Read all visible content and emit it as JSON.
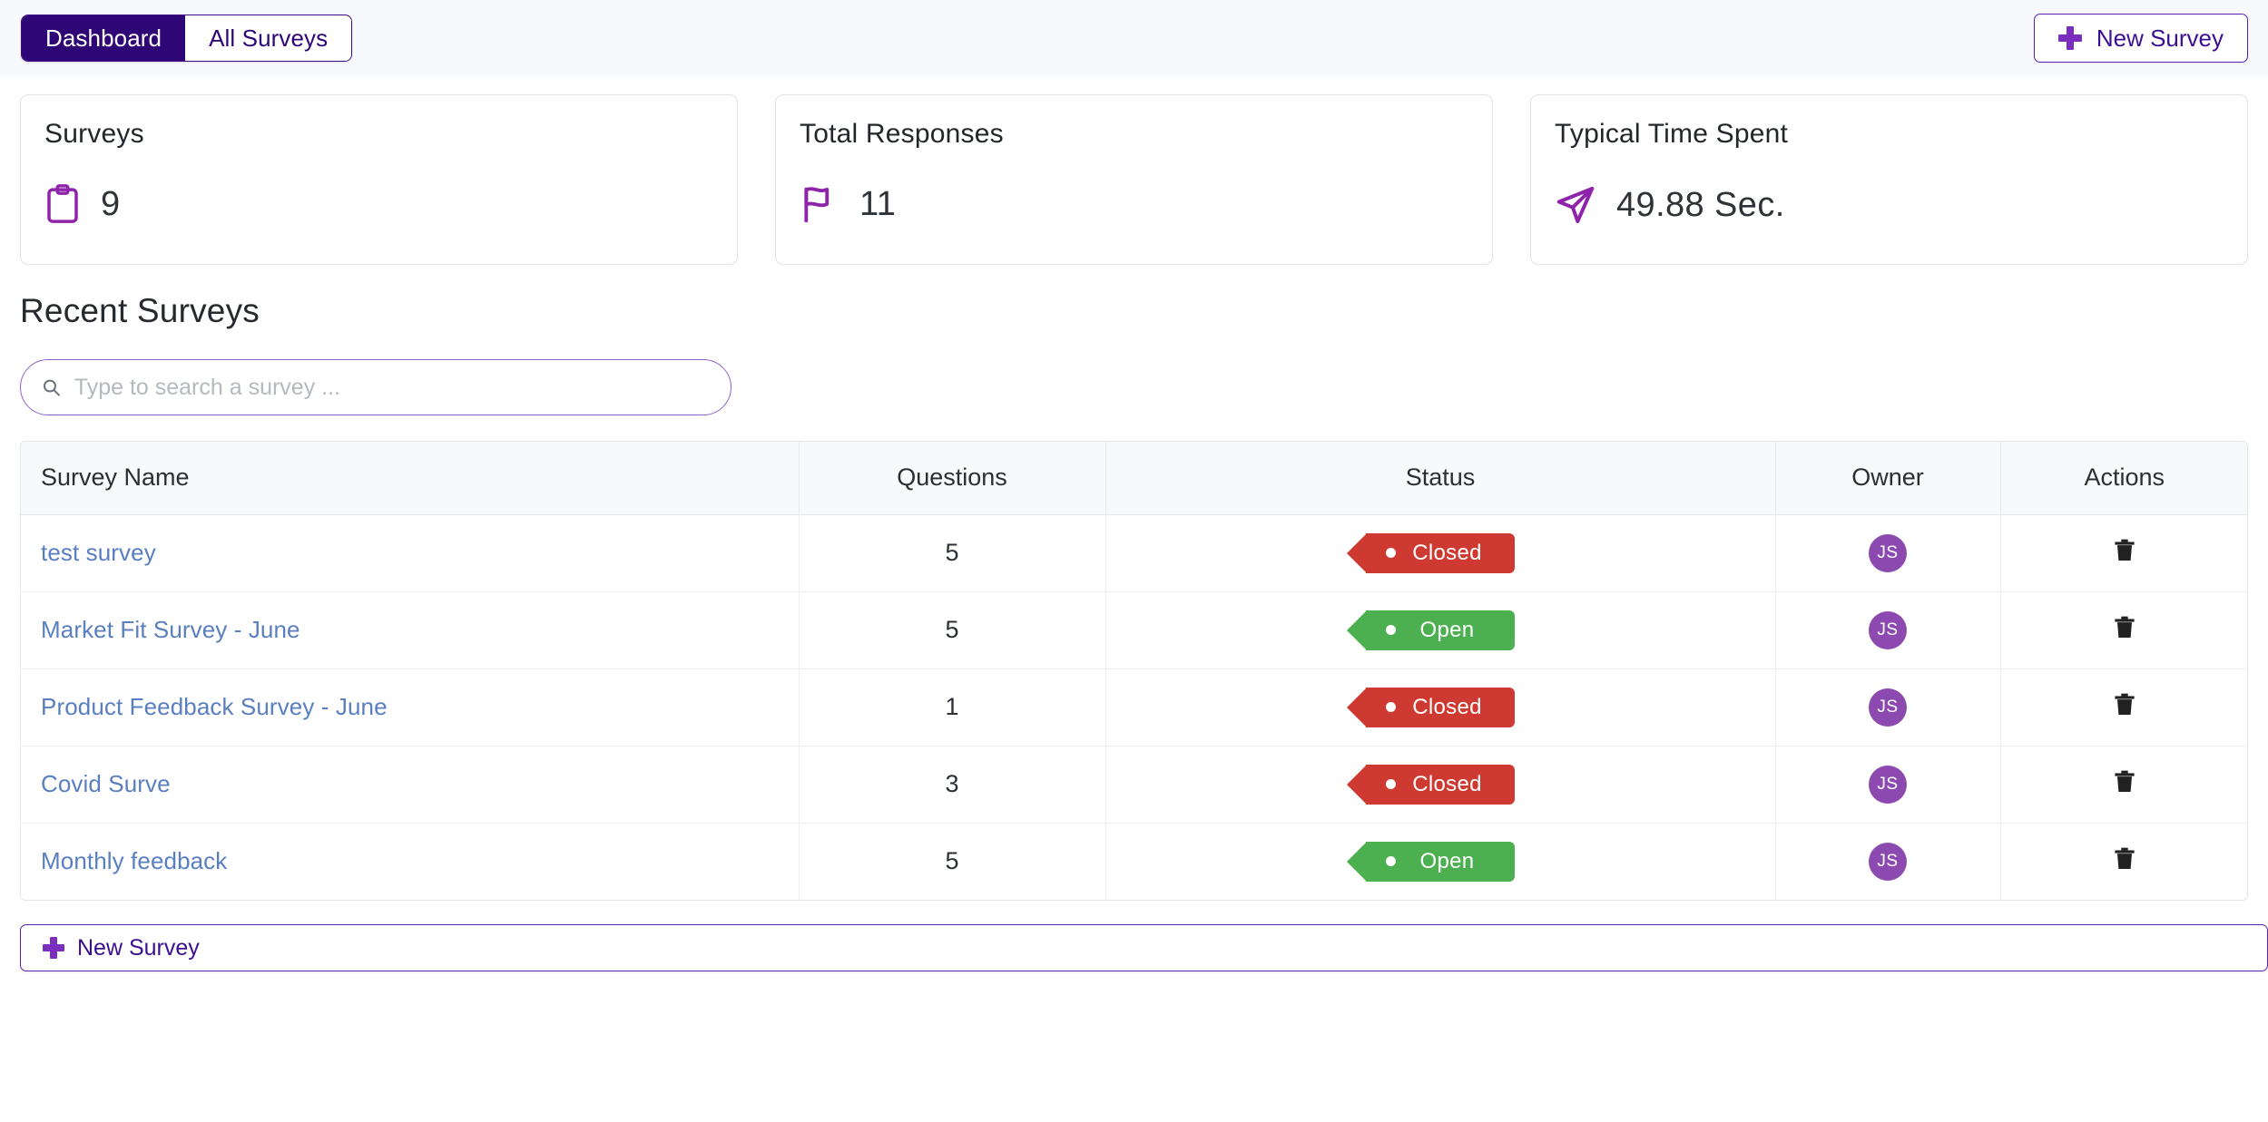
{
  "header": {
    "tabs": [
      {
        "label": "Dashboard",
        "active": true
      },
      {
        "label": "All Surveys",
        "active": false
      }
    ],
    "new_survey_label": "New Survey"
  },
  "stats": [
    {
      "title": "Surveys",
      "value": "9",
      "icon": "clipboard-icon",
      "icon_color": "#8e24aa"
    },
    {
      "title": "Total Responses",
      "value": "11",
      "icon": "flag-icon",
      "icon_color": "#8e24aa"
    },
    {
      "title": "Typical Time Spent",
      "value": "49.88 Sec.",
      "icon": "send-arrow-icon",
      "icon_color": "#8e24aa"
    }
  ],
  "recent": {
    "title": "Recent Surveys",
    "search_placeholder": "Type to search a survey ...",
    "search_value": "",
    "columns": [
      "Survey Name",
      "Questions",
      "Status",
      "Owner",
      "Actions"
    ],
    "rows": [
      {
        "name": "test survey",
        "questions": "5",
        "status": "Closed",
        "status_kind": "closed",
        "owner": "JS",
        "action": "delete-icon"
      },
      {
        "name": "Market Fit Survey - June",
        "questions": "5",
        "status": "Open",
        "status_kind": "open",
        "owner": "JS",
        "action": "delete-icon"
      },
      {
        "name": "Product Feedback Survey - June",
        "questions": "1",
        "status": "Closed",
        "status_kind": "closed",
        "owner": "JS",
        "action": "delete-icon"
      },
      {
        "name": "Covid Surve",
        "questions": "3",
        "status": "Closed",
        "status_kind": "closed",
        "owner": "JS",
        "action": "delete-icon"
      },
      {
        "name": "Monthly feedback",
        "questions": "5",
        "status": "Open",
        "status_kind": "open",
        "owner": "JS",
        "action": "delete-icon"
      }
    ]
  },
  "footer": {
    "new_survey_label": "New Survey"
  },
  "colors": {
    "brand_dark": "#2e0675",
    "brand_purple": "#7b2fbe",
    "link_blue": "#5a7fc0",
    "status_closed": "#ce3a32",
    "status_open": "#4caf50",
    "avatar": "#8c4ab0"
  }
}
